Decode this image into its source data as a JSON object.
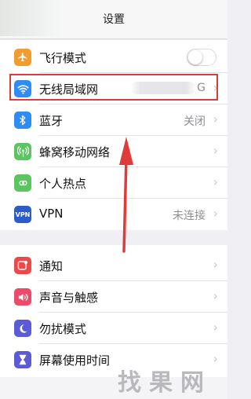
{
  "header": {
    "title": "设置"
  },
  "group1": [
    {
      "id": "airplane",
      "label": "飞行模式",
      "icon": "airplane-icon",
      "icon_color": "#f29b2f",
      "control": "toggle",
      "toggle_on": false
    },
    {
      "id": "wifi",
      "label": "无线局域网",
      "icon": "wifi-icon",
      "icon_color": "#2f8cf5",
      "value": "G",
      "highlighted": true
    },
    {
      "id": "bluetooth",
      "label": "蓝牙",
      "icon": "bluetooth-icon",
      "icon_color": "#2f8cf5",
      "value": "关闭"
    },
    {
      "id": "cellular",
      "label": "蜂窝移动网络",
      "icon": "antenna-icon",
      "icon_color": "#5bc561"
    },
    {
      "id": "hotspot",
      "label": "个人热点",
      "icon": "hotspot-icon",
      "icon_color": "#5bc561"
    },
    {
      "id": "vpn",
      "label": "VPN",
      "icon": "vpn-icon",
      "icon_color": "#2b5cc8",
      "icon_text": "VPN",
      "value": "未连接"
    }
  ],
  "group2": [
    {
      "id": "notifications",
      "label": "通知",
      "icon": "notification-icon",
      "icon_color": "#ec4a4a"
    },
    {
      "id": "sounds",
      "label": "声音与触感",
      "icon": "speaker-icon",
      "icon_color": "#ec4a6a"
    },
    {
      "id": "dnd",
      "label": "勿扰模式",
      "icon": "moon-icon",
      "icon_color": "#5b5bd6"
    },
    {
      "id": "screentime",
      "label": "屏幕使用时间",
      "icon": "hourglass-icon",
      "icon_color": "#5b5bd6"
    }
  ],
  "watermark": "找果网",
  "colors": {
    "highlight_box": "#e03a3a",
    "arrow": "#e03a3a"
  }
}
